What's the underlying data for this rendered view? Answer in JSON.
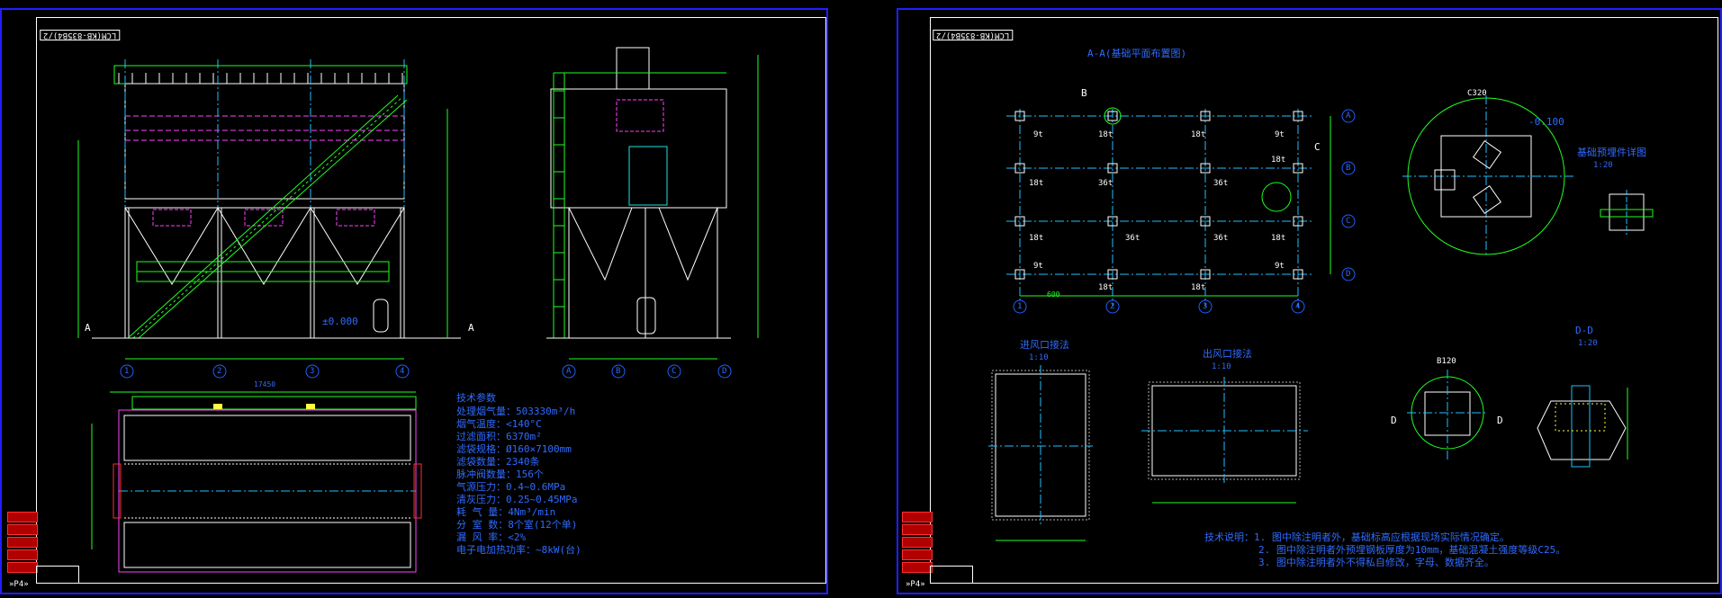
{
  "sheet1": {
    "drawing_no": "LCM(KB-835B4)/2",
    "sheet_tag": "»P4»",
    "title_block_rows": [
      "",
      "",
      "",
      "",
      ""
    ],
    "labels": {
      "section_a_left": "A",
      "section_a_right": "A",
      "elevation_zero": "±0.000",
      "length_total": "17450"
    },
    "axis_front": [
      "1",
      "2",
      "3",
      "4"
    ],
    "axis_side": [
      "A",
      "B",
      "C",
      "D"
    ],
    "tech_params_title": "技术参数",
    "tech_params": [
      "处理烟气量：503330m³/h",
      "烟气温度：<140°C",
      "过滤面积：6370m²",
      "滤袋规格：Ø160×7100mm",
      "滤袋数量：2340条",
      "脉冲阀数量：156个",
      "气源压力：0.4~0.6MPa",
      "清灰压力：0.25~0.45MPa",
      "耗 气 量：4Nm³/min",
      "分 室 数：8个室(12个单)",
      "漏 风 率：<2%",
      "电子电加热功率：~8kW(台)"
    ]
  },
  "sheet2": {
    "drawing_no": "LCM(KB-835B4)/2",
    "sheet_tag": "»P4»",
    "foundation_title": "A-A(基础平面布置图)",
    "labels": {
      "B": "B",
      "C": "C",
      "D_left": "D",
      "D_right": "D",
      "circle_top": "C320",
      "circle_bottom": "B120",
      "dd_title": "D-D",
      "dd_scale": "1:20",
      "inlet_title": "进风口接法",
      "inlet_scale": "1:10",
      "outlet_title": "出风口接法",
      "outlet_scale": "1:10",
      "anchor_title": "基础预埋件详图",
      "anchor_scale": "1:20",
      "elev_minus": "-0.100",
      "dim_600": "600"
    },
    "loads": [
      [
        "9t",
        "18t",
        "18t",
        "9t"
      ],
      [
        "18t",
        "36t",
        "36t",
        "18t"
      ],
      [
        "18t",
        "36t",
        "36t",
        "18t"
      ],
      [
        "9t",
        "18t",
        "18t",
        "9t"
      ]
    ],
    "axis_bottom": [
      "1",
      "2",
      "3",
      "4"
    ],
    "axis_right": [
      "A",
      "B",
      "C",
      "D"
    ],
    "notes": [
      "技术说明：1. 图中除注明者外，基础标高应根据现场实际情况确定。",
      "2. 图中除注明者外预埋钢板厚度为10mm，基础混凝土强度等级C25。",
      "3. 图中除注明者外不得私自修改，字母、数据齐全。"
    ]
  }
}
